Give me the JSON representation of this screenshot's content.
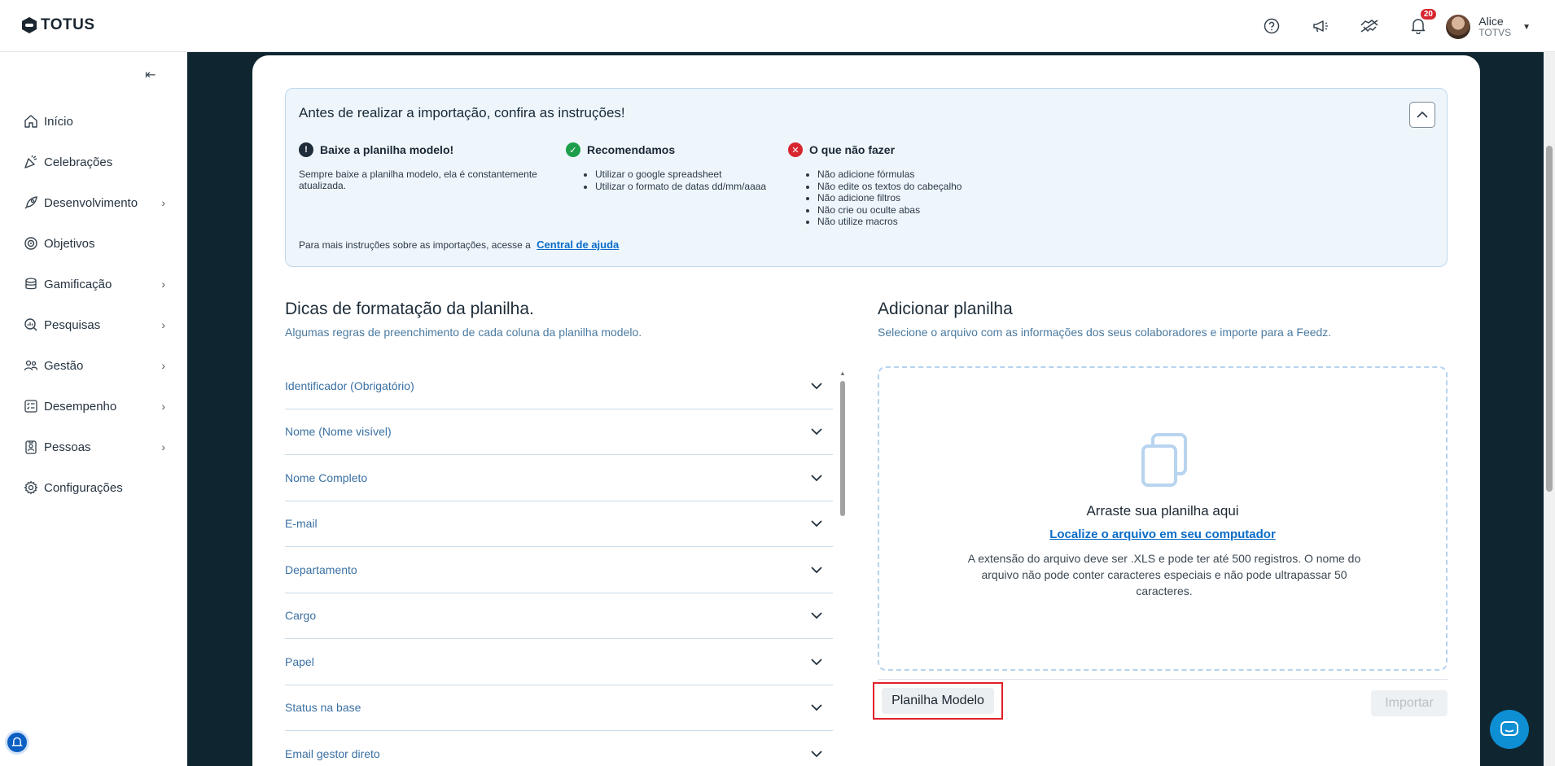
{
  "header": {
    "logo_text": "TOTUS",
    "notifications_count": "20",
    "user_name": "Alice",
    "user_org": "TOTVS"
  },
  "sidebar": {
    "items": [
      {
        "label": "Início",
        "icon": "home-icon",
        "has_submenu": false
      },
      {
        "label": "Celebrações",
        "icon": "party-icon",
        "has_submenu": false
      },
      {
        "label": "Desenvolvimento",
        "icon": "rocket-icon",
        "has_submenu": true
      },
      {
        "label": "Objetivos",
        "icon": "target-icon",
        "has_submenu": false
      },
      {
        "label": "Gamificação",
        "icon": "coins-icon",
        "has_submenu": true
      },
      {
        "label": "Pesquisas",
        "icon": "search-chart-icon",
        "has_submenu": true
      },
      {
        "label": "Gestão",
        "icon": "people-icon",
        "has_submenu": true
      },
      {
        "label": "Desempenho",
        "icon": "checklist-icon",
        "has_submenu": true
      },
      {
        "label": "Pessoas",
        "icon": "badge-icon",
        "has_submenu": true
      },
      {
        "label": "Configurações",
        "icon": "gear-icon",
        "has_submenu": false
      }
    ]
  },
  "instructions": {
    "title": "Antes de realizar a importação, confira as instruções!",
    "col1_title": "Baixe a planilha modelo!",
    "col1_text": "Sempre baixe a planilha modelo, ela é constantemente atualizada.",
    "col2_title": "Recomendamos",
    "col2_items": [
      "Utilizar o google spreadsheet",
      "Utilizar o formato de datas dd/mm/aaaa"
    ],
    "col3_title": "O que não fazer",
    "col3_items": [
      "Não adicione fórmulas",
      "Não edite os textos do cabeçalho",
      "Não adicione filtros",
      "Não crie ou oculte abas",
      "Não utilize macros"
    ],
    "footer_text": "Para mais instruções sobre as importações, acesse a",
    "footer_link": "Central de ajuda",
    "colors": {
      "warning": "#1f2d3a",
      "success": "#1e9e4a",
      "error": "#d7262e"
    }
  },
  "tips": {
    "title": "Dicas de formatação da planilha.",
    "subtitle": "Algumas regras de preenchimento de cada coluna da planilha modelo.",
    "fields": [
      "Identificador (Obrigatório)",
      "Nome (Nome visível)",
      "Nome Completo",
      "E-mail",
      "Departamento",
      "Cargo",
      "Papel",
      "Status na base",
      "Email gestor direto"
    ]
  },
  "upload": {
    "title": "Adicionar planilha",
    "subtitle": "Selecione o arquivo com as informações dos seus colaboradores e importe para a Feedz.",
    "drop_title": "Arraste sua planilha aqui",
    "drop_link": "Localize o arquivo em seu computador",
    "drop_note": "A extensão do arquivo deve ser .XLS e pode ter até 500 registros. O nome do arquivo não pode conter caracteres especiais e não pode ultrapassar 50 caracteres.",
    "model_button": "Planilha Modelo",
    "import_button": "Importar"
  }
}
